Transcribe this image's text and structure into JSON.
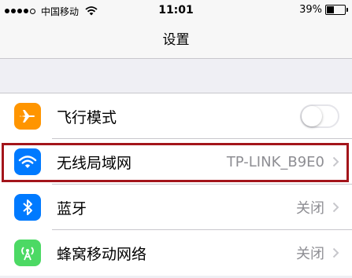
{
  "statusbar": {
    "carrier": "中国移动",
    "time": "11:01",
    "battery_text": "39%",
    "battery_level": 0.39
  },
  "navbar": {
    "title": "设置"
  },
  "rows": [
    {
      "label": "飞行模式",
      "icon": "airplane-icon",
      "color": "#ff9500",
      "toggle": "off"
    },
    {
      "label": "无线局域网",
      "icon": "wifi-icon",
      "color": "#007aff",
      "value": "TP-LINK_B9E0"
    },
    {
      "label": "蓝牙",
      "icon": "bluetooth-icon",
      "color": "#007aff",
      "value": "关闭"
    },
    {
      "label": "蜂窝移动网络",
      "icon": "cellular-antenna-icon",
      "color": "#4cd964",
      "value": "关闭"
    }
  ]
}
